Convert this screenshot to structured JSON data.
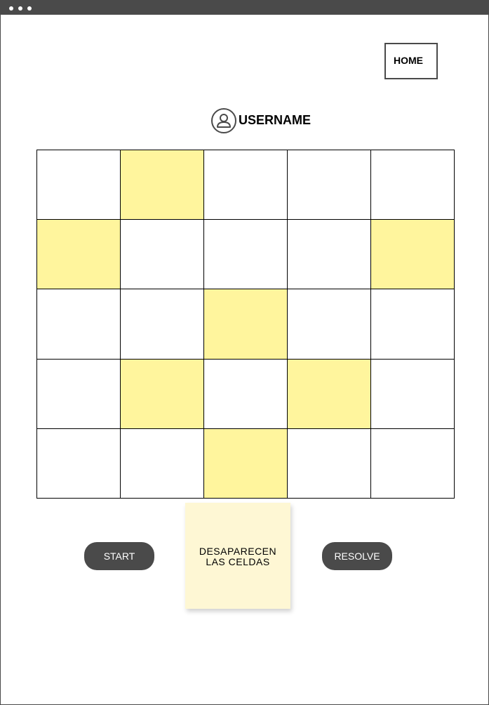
{
  "window": {
    "dots": [
      "dot",
      "dot",
      "dot"
    ]
  },
  "header": {
    "home_label": "HOME"
  },
  "user": {
    "icon": "user-circle-icon",
    "username": "USERNAME"
  },
  "grid": {
    "rows": 5,
    "cols": 5,
    "highlight_color": "#fff59d",
    "cells": [
      [
        false,
        true,
        false,
        false,
        false
      ],
      [
        true,
        false,
        false,
        false,
        true
      ],
      [
        false,
        false,
        true,
        false,
        false
      ],
      [
        false,
        true,
        false,
        true,
        false
      ],
      [
        false,
        false,
        true,
        false,
        false
      ]
    ]
  },
  "controls": {
    "start_label": "START",
    "resolve_label": "RESOLVE",
    "note_line1": "DESAPARECEN",
    "note_line2": "LAS CELDAS"
  },
  "colors": {
    "dark": "#4a4a4a",
    "note_bg": "#fef7d4"
  }
}
